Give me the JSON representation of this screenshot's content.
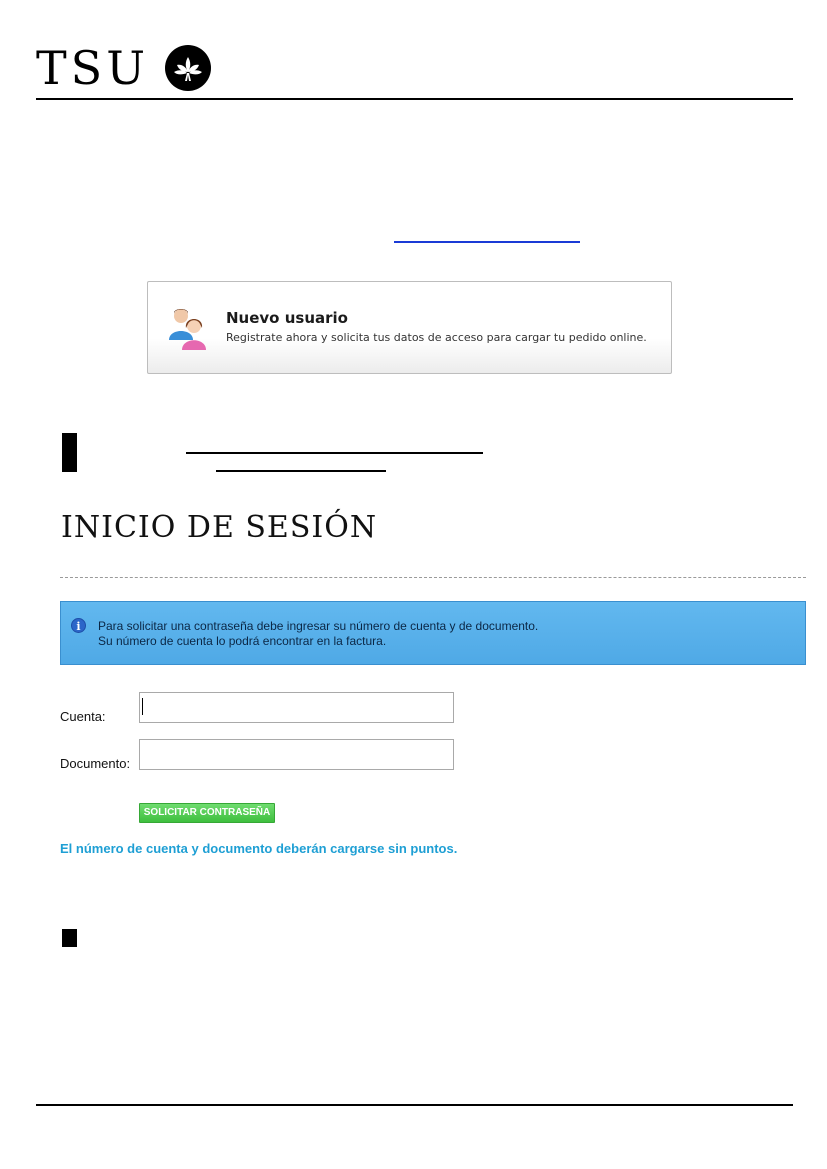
{
  "header": {
    "logo_text": "TSU",
    "emblem": "lotus-flower-icon"
  },
  "new_user": {
    "title": "Nuevo usuario",
    "description": "Registrate ahora y solicita tus datos de acceso para cargar tu pedido online.",
    "icon": "users-icon"
  },
  "login": {
    "title": "INICIO DE SESIÓN"
  },
  "info": {
    "icon": "info-icon",
    "line1": "Para solicitar una contraseña debe ingresar su número de cuenta y de documento.",
    "line2": "Su número de cuenta lo podrá encontrar en la factura."
  },
  "form": {
    "cuenta_label": "Cuenta:",
    "cuenta_value": "",
    "documento_label": "Documento:",
    "documento_value": "",
    "submit_label": "SOLICITAR CONTRASEÑA",
    "note": "El número de cuenta y documento deberán cargarse sin puntos."
  },
  "colors": {
    "info_bg": "#5bb3ec",
    "button_bg": "#4ccb4c",
    "note_text": "#1e9fd4",
    "link": "#1a3bd6"
  }
}
